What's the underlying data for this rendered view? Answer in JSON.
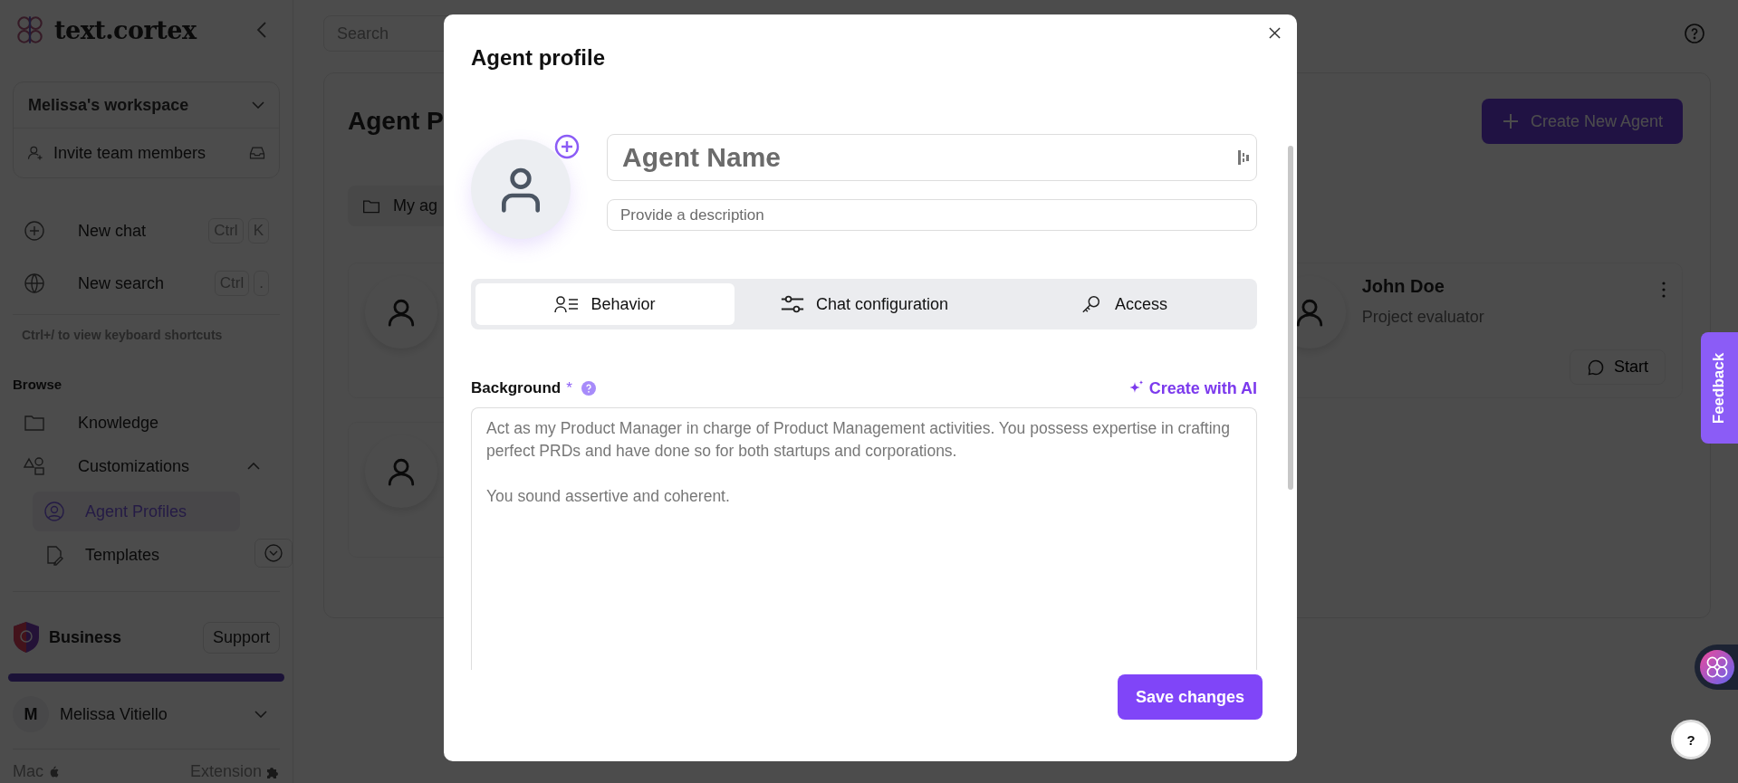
{
  "sidebar": {
    "logo": "text.cortex",
    "workspace": "Melissa's workspace",
    "invite": "Invite team members",
    "actions": [
      {
        "label": "New chat",
        "keys": [
          "Ctrl",
          "K"
        ]
      },
      {
        "label": "New search",
        "keys": [
          "Ctrl",
          "."
        ]
      }
    ],
    "shortcut_hint": "Ctrl+/ to view keyboard shortcuts",
    "browse_heading": "Browse",
    "nav": [
      {
        "label": "Knowledge",
        "kind": "folder"
      },
      {
        "label": "Customizations",
        "kind": "shapes",
        "expanded": true,
        "children": [
          {
            "label": "Agent Profiles",
            "kind": "person",
            "selected": true
          },
          {
            "label": "Templates",
            "kind": "template",
            "selected": false
          }
        ]
      }
    ],
    "plan": "Business",
    "support": "Support",
    "usage": {
      "level": 1
    },
    "user": {
      "initial": "M",
      "name": "Melissa Vitiello"
    },
    "footer": [
      "Mac",
      "Extension"
    ]
  },
  "main": {
    "search_placeholder": "Search",
    "title": "Agent P",
    "create_button": "Create New Agent",
    "folder_tab": "My ag",
    "agent_cards": [
      {
        "kind": "covered"
      },
      {
        "kind": "full",
        "name": "John Doe",
        "role": "Project evaluator",
        "action": "Start"
      },
      {
        "kind": "covered"
      }
    ]
  },
  "modal": {
    "title": "Agent profile",
    "name_placeholder": "Agent Name",
    "description_placeholder": "Provide a description",
    "tabs": [
      {
        "label": "Behavior",
        "kind": "behavior",
        "selected": true
      },
      {
        "label": "Chat configuration",
        "kind": "sliders",
        "selected": false
      },
      {
        "label": "Access",
        "kind": "key",
        "selected": false
      }
    ],
    "background_label": "Background",
    "required_mark": "*",
    "create_with_ai": "Create with AI",
    "background_value": "Act as my Product Manager in charge of Product Management activities. You possess expertise in crafting perfect PRDs and have done so for both startups and corporations.\n\nYou sound assertive and coherent.",
    "save_button": "Save changes"
  },
  "feedback": "Feedback",
  "help": "?"
}
